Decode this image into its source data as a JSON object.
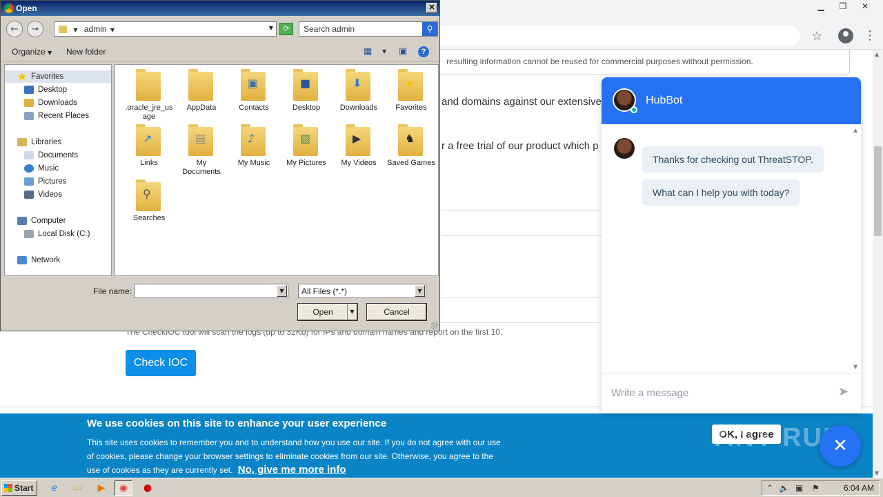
{
  "browser": {
    "notice_text": "resulting information cannot be reused for commercial purposes without permission.",
    "para1": "and domains against our extensive",
    "para2": "r a free trial of our product which p",
    "scan_text": "The CheckIOC tool will scan the logs (up to 32Kb) for IPs and domain names and report on the first 10.",
    "check_button": "Check IOC"
  },
  "cookie": {
    "title": "We use cookies on this site to enhance your user experience",
    "text": "This site uses cookies to remember you and to understand how you use our site. If you do not agree with our use of cookies, please change your browser settings to eliminate cookies from our site. Otherwise, you agree to the use of cookies as they are currently set.",
    "link": "No, give me more info",
    "ok_button": "OK, I agree",
    "watermark": "ANY RUN"
  },
  "chat": {
    "title": "HubBot",
    "messages": [
      "Thanks for checking out ThreatSTOP.",
      "What can I help you with today?"
    ],
    "input_placeholder": "Write a message",
    "accent": "#2572f4"
  },
  "dialog": {
    "title": "Open",
    "address": "admin",
    "search_placeholder": "Search admin",
    "toolbar": {
      "organize": "Organize",
      "new_folder": "New folder"
    },
    "nav": {
      "favorites": "Favorites",
      "desktop": "Desktop",
      "downloads": "Downloads",
      "recent": "Recent Places",
      "libraries": "Libraries",
      "documents": "Documents",
      "music": "Music",
      "pictures": "Pictures",
      "videos": "Videos",
      "computer": "Computer",
      "local_disk": "Local Disk (C:)",
      "network": "Network"
    },
    "files": [
      {
        "name": ".oracle_jre_usage",
        "icon": "folder-icon"
      },
      {
        "name": "AppData",
        "icon": "folder-icon"
      },
      {
        "name": "Contacts",
        "icon": "contacts-folder-icon"
      },
      {
        "name": "Desktop",
        "icon": "desktop-folder-icon"
      },
      {
        "name": "Downloads",
        "icon": "downloads-folder-icon"
      },
      {
        "name": "Favorites",
        "icon": "favorites-folder-icon"
      },
      {
        "name": "Links",
        "icon": "links-folder-icon"
      },
      {
        "name": "My Documents",
        "icon": "documents-folder-icon"
      },
      {
        "name": "My Music",
        "icon": "music-folder-icon"
      },
      {
        "name": "My Pictures",
        "icon": "pictures-folder-icon"
      },
      {
        "name": "My Videos",
        "icon": "videos-folder-icon"
      },
      {
        "name": "Saved Games",
        "icon": "saved-games-folder-icon"
      },
      {
        "name": "Searches",
        "icon": "searches-folder-icon"
      }
    ],
    "file_name_label": "File name:",
    "file_name_value": "",
    "file_type": "All Files (*.*)",
    "open_button": "Open",
    "cancel_button": "Cancel"
  },
  "taskbar": {
    "start": "Start",
    "clock": "6:04 AM"
  }
}
